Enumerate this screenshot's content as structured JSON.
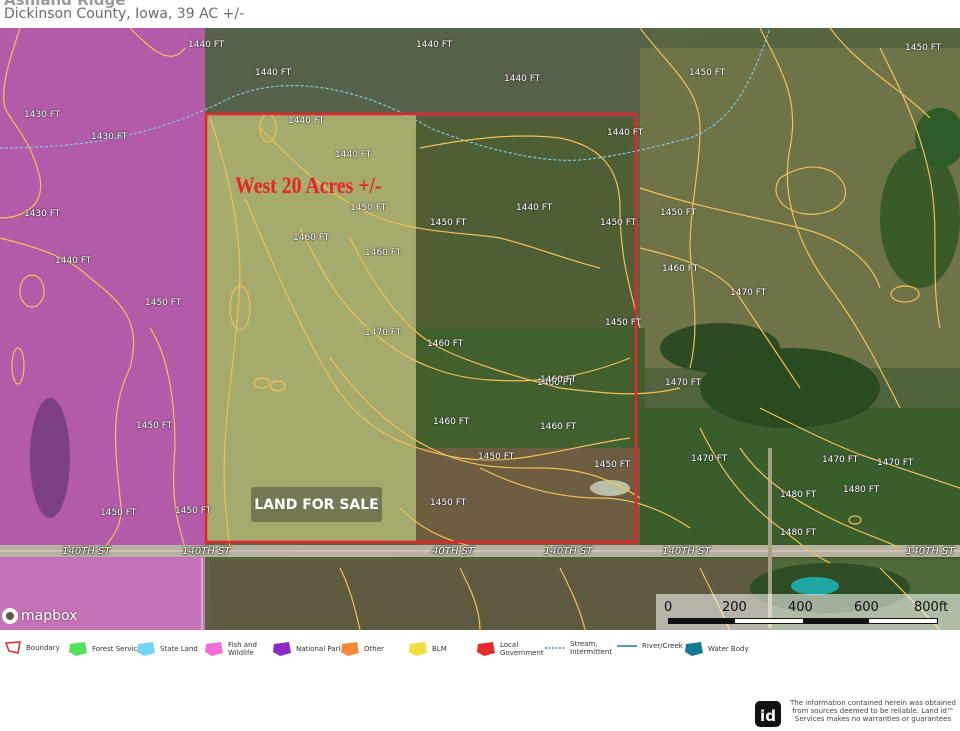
{
  "header": {
    "title": "Ashland Ridge",
    "subtitle": "Dickinson County, Iowa, 39 AC +/-"
  },
  "map": {
    "parcel_label": "West 20 Acres +/-",
    "sale_badge": "LAND FOR SALE",
    "boundary_color": "#e8232a",
    "roads": [
      "140TH ST",
      "140TH ST",
      "40TH ST",
      "140TH ST",
      "140TH ST",
      "140TH ST"
    ],
    "contour_labels": [
      "1440 FT",
      "1440 FT",
      "1440 FT",
      "1440 FT",
      "1450 FT",
      "1450 FT",
      "1430 FT",
      "1430 FT",
      "1430 FT",
      "1440 FT",
      "1450 FT",
      "1450 FT",
      "1450 FT",
      "1450 FT",
      "1450 FT",
      "1450 FT",
      "1440 FT",
      "1450 FT",
      "1450 FT",
      "1460 FT",
      "1460 FT",
      "1460 FT",
      "1460 FT",
      "1460 FT",
      "1470 FT",
      "1470 FT",
      "1470 FT",
      "1470 FT",
      "1470 FT",
      "1480 FT",
      "1480 FT",
      "1480 FT",
      "1460 FT",
      "1450 FT",
      "1460 FT",
      "1450 FT",
      "1440 FT",
      "1440 FT",
      "1440 FT",
      "1450 FT",
      "1450 FT",
      "1470 FT",
      "1460 FT"
    ],
    "attribution": "mapbox",
    "scale": {
      "labels": [
        "0",
        "200",
        "400",
        "600",
        "800ft"
      ]
    }
  },
  "legend": [
    {
      "label": "Boundary",
      "color": "#e8232a",
      "icon": "boundary-outline-icon"
    },
    {
      "label": "Forest Servic",
      "color": "#54e05a",
      "icon": "forest-service-polygon-icon"
    },
    {
      "label": "State Land",
      "color": "#76d3f2",
      "icon": "state-land-polygon-icon"
    },
    {
      "label": "Fish and Wildlife",
      "color": "#f070d8",
      "icon": "fish-wildlife-polygon-icon"
    },
    {
      "label": "National Parl",
      "color": "#8a28c8",
      "icon": "national-park-polygon-icon"
    },
    {
      "label": "Other",
      "color": "#f28a3c",
      "icon": "other-polygon-icon"
    },
    {
      "label": "BLM",
      "color": "#f2de3a",
      "icon": "blm-polygon-icon"
    },
    {
      "label": "Local Government",
      "color": "#e32b2b",
      "icon": "local-government-polygon-icon"
    },
    {
      "label": "Stream, Intermittent",
      "color": "#2e8fa8",
      "icon": "stream-intermittent-line-icon"
    },
    {
      "label": "River/Creek",
      "color": "#1d7a96",
      "icon": "river-creek-line-icon"
    },
    {
      "label": "Water Body",
      "color": "#16798f",
      "icon": "water-body-polygon-icon"
    }
  ],
  "footer": {
    "logo_text": "id",
    "disclaimer": "The information contained herein was obtained from sources deemed to be reliable. Land id™ Services makes no warranties or guarantees"
  }
}
